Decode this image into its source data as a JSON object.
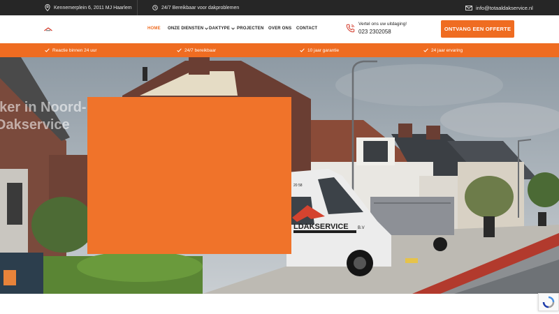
{
  "topbar": {
    "address": "Kennemerplein 6, 2011 MJ Haarlem",
    "availability": "24/7 Bereikbaar voor dakproblemen",
    "email": "info@totaaldakservice.nl"
  },
  "nav": {
    "items": [
      {
        "label": "HOME",
        "active": true,
        "dropdown": false
      },
      {
        "label": "ONZE DIENSTEN",
        "active": false,
        "dropdown": true
      },
      {
        "label": "DAKTYPE",
        "active": false,
        "dropdown": true
      },
      {
        "label": "PROJECTEN",
        "active": false,
        "dropdown": false
      },
      {
        "label": "OVER ONS",
        "active": false,
        "dropdown": false
      },
      {
        "label": "CONTACT",
        "active": false,
        "dropdown": false
      }
    ]
  },
  "call": {
    "prompt": "Vertel ons uw uitdaging!",
    "phone": "023 2302058"
  },
  "cta": {
    "label": "ONTVANG EEN OFFERTE"
  },
  "features": [
    {
      "label": "Reactie binnen 24 uur",
      "icon": "check-icon"
    },
    {
      "label": "24/7 bereikbaar",
      "icon": "check-icon"
    },
    {
      "label": "10 jaar garantie",
      "icon": "check-icon"
    },
    {
      "label": "24 jaar ervaring",
      "icon": "check-icon"
    }
  ],
  "hero": {
    "title_line1": "kker in Noord-Holland",
    "title_line2": "Dakservice",
    "van_text": "LDAKSERVICE",
    "van_suffix": "B.V",
    "van_phone": "20 58"
  },
  "colors": {
    "accent": "#ef6c21",
    "topbar_bg": "#262626"
  }
}
